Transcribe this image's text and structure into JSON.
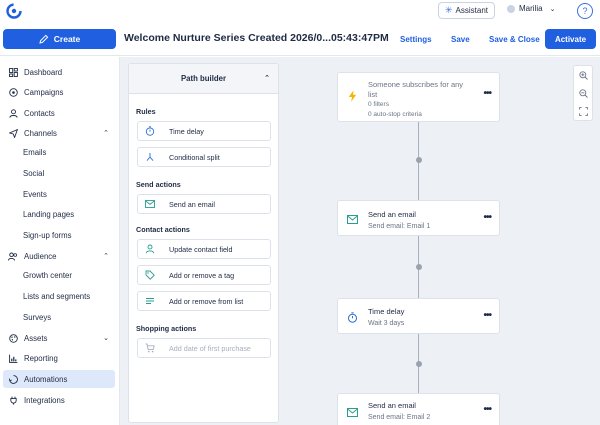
{
  "topbar": {
    "assistant_label": "Assistant",
    "user_name": "Marilia",
    "help_label": "?"
  },
  "header": {
    "create_label": "Create",
    "title": "Welcome Nurture Series Created 2026/0...05:43:47PM",
    "settings_label": "Settings",
    "save_label": "Save",
    "save_close_label": "Save & Close",
    "activate_label": "Activate"
  },
  "sidebar": {
    "items": [
      {
        "label": "Dashboard"
      },
      {
        "label": "Campaigns"
      },
      {
        "label": "Contacts"
      },
      {
        "label": "Channels"
      },
      {
        "label": "Audience"
      },
      {
        "label": "Assets"
      },
      {
        "label": "Reporting"
      },
      {
        "label": "Automations"
      },
      {
        "label": "Integrations"
      }
    ],
    "channels_sub": [
      "Emails",
      "Social",
      "Events",
      "Landing pages",
      "Sign-up forms"
    ],
    "audience_sub": [
      "Growth center",
      "Lists and segments",
      "Surveys"
    ]
  },
  "path_builder": {
    "title": "Path builder",
    "sections": {
      "rules": "Rules",
      "send_actions": "Send actions",
      "contact_actions": "Contact actions",
      "shopping_actions": "Shopping actions"
    },
    "items": {
      "time_delay": "Time delay",
      "conditional_split": "Conditional split",
      "send_email": "Send an email",
      "update_contact": "Update contact field",
      "add_remove_tag": "Add or remove a tag",
      "add_remove_list": "Add or remove from list",
      "add_purchase": "Add date of first purchase"
    }
  },
  "flow": {
    "trigger": {
      "title": "Someone subscribes for any list",
      "filters": "0 filters",
      "autostop": "0 auto-stop criteria"
    },
    "step1": {
      "title": "Send an email",
      "sub": "Send email: Email 1"
    },
    "step2": {
      "title": "Time delay",
      "sub": "Wait 3 days"
    },
    "step3": {
      "title": "Send an email",
      "sub": "Send email: Email 2"
    }
  },
  "colors": {
    "brand_blue": "#1f5fe0",
    "teal_icon": "#2a9d8f",
    "trigger_icon": "#f2b705",
    "active_nav_bg": "#dde9fb"
  }
}
